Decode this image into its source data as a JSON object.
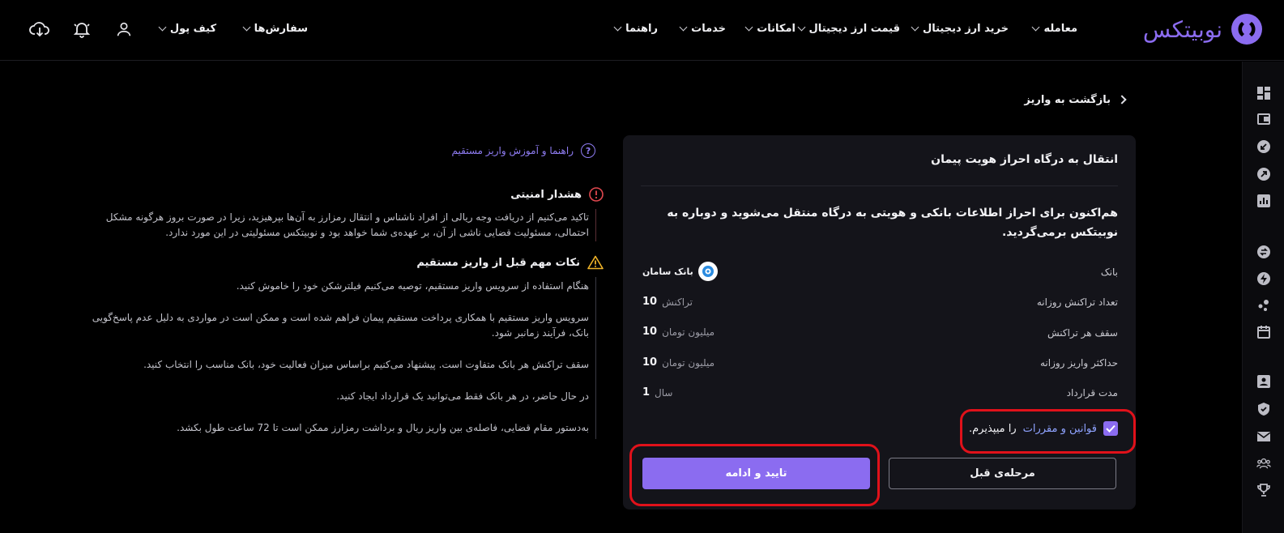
{
  "header": {
    "logo_text": "نوبیتکس",
    "nav": [
      {
        "label": "معامله"
      },
      {
        "label": "خرید ارز دیجیتال"
      },
      {
        "label": "قیمت ارز دیجیتال"
      },
      {
        "label": "امکانات"
      },
      {
        "label": "خدمات"
      },
      {
        "label": "راهنما"
      }
    ],
    "nav_left": [
      {
        "label": "سفارش‌ها"
      },
      {
        "label": "کیف پول"
      }
    ],
    "icons": [
      "user-icon",
      "bell-icon",
      "download-cloud-icon"
    ]
  },
  "back": {
    "label": "بازگشت به واریز"
  },
  "card": {
    "title": "انتقال به درگاه احراز هویت پیمان",
    "description": "هم‌اکنون برای احراز اطلاعات بانکی و هویتی به درگاه منتقل می‌شوید و دوباره به نوبیتکس برمی‌گردید.",
    "rows": [
      {
        "label": "بانک",
        "value": "بانک سامان",
        "unit": ""
      },
      {
        "label": "تعداد تراکنش روزانه",
        "value": "10",
        "unit": "تراکنش"
      },
      {
        "label": "سقف هر تراکنش",
        "value": "10",
        "unit": "میلیون تومان"
      },
      {
        "label": "حداکثر واریز روزانه",
        "value": "10",
        "unit": "میلیون تومان"
      },
      {
        "label": "مدت قرارداد",
        "value": "1",
        "unit": "سال"
      }
    ],
    "terms_link": "قوانین و مقررات",
    "terms_suffix": "را میپذیرم.",
    "terms_checked": true,
    "btn_prev": "مرحله‌ی قبل",
    "btn_confirm": "تایید و ادامه"
  },
  "guide": {
    "label": "راهنما و آموزش واریز مستقیم"
  },
  "security": {
    "title": "هشدار امنیتی",
    "body": "تاکید می‌کنیم از دریافت وجه ریالی از افراد ناشناس و انتقال رمزارز به آن‌ها بپرهیزید، زیرا در صورت بروز هرگونه مشکل احتمالی، مسئولیت قضایی ناشی از آن، بر عهده‌ی شما خواهد بود و نوبیتکس مسئولیتی در این مورد ندارد."
  },
  "tips": {
    "title": "نکات مهم قبل از واریز مستقیم",
    "items": [
      "هنگام استفاده از سرویس واریز مستقیم، توصیه می‌کنیم فیلترشکن خود را خاموش کنید.",
      "سرویس واریز مستقیم با همکاری پرداخت مستقیم پیمان فراهم شده است و ممکن است در مواردی به دلیل عدم پاسخ‌گویی بانک، فرآیند زمانبر شود.",
      "سقف تراکنش هر بانک متفاوت است. پیشنهاد می‌کنیم براساس میزان فعالیت خود، بانک مناسب را انتخاب کنید.",
      "در حال حاضر، در هر بانک فقط می‌توانید یک قرارداد ایجاد کنید.",
      "به‌دستور مقام قضایی، فاصله‌ی بین واریز ریال و برداشت رمزارز ممکن است تا 72 ساعت طول بکشد."
    ]
  },
  "colors": {
    "accent": "#8b6cf0",
    "highlight": "#e0111a",
    "link": "#8fa3ff"
  }
}
